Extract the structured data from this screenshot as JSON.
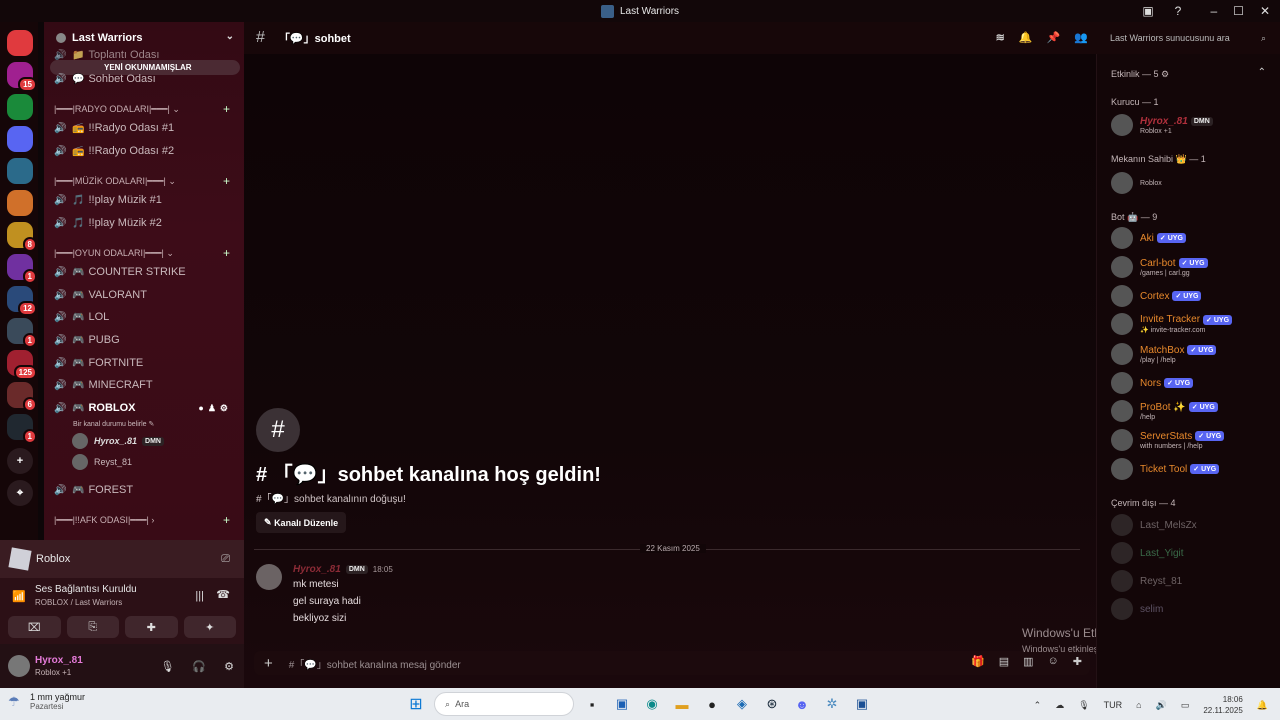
{
  "window": {
    "title": "Last Warriors"
  },
  "servers": [
    {
      "icon": "discord-logo-icon",
      "color": "#e03a3e",
      "badge": ""
    },
    {
      "icon": "server-icon",
      "color": "#a02090",
      "badge": "15"
    },
    {
      "icon": "server-icon",
      "color": "#1a8a3a",
      "badge": ""
    },
    {
      "icon": "server-icon",
      "color": "#5865f2",
      "badge": ""
    },
    {
      "icon": "server-icon",
      "color": "#2b6a8a",
      "badge": ""
    },
    {
      "icon": "server-icon",
      "color": "#d0702a",
      "badge": ""
    },
    {
      "icon": "server-icon",
      "color": "#c09020",
      "badge": "8"
    },
    {
      "icon": "server-icon",
      "color": "#7030a0",
      "badge": "1"
    },
    {
      "icon": "server-icon",
      "color": "#2a4a7a",
      "badge": "12"
    },
    {
      "icon": "server-icon",
      "color": "#3a4a5a",
      "badge": "1"
    },
    {
      "icon": "server-icon",
      "color": "#a02030",
      "badge": "125"
    },
    {
      "icon": "server-icon",
      "color": "#6a2a2a",
      "badge": "6"
    },
    {
      "icon": "server-icon",
      "color": "#202830",
      "badge": "1"
    }
  ],
  "sidebar": {
    "server_name": "Last Warriors",
    "unread_pill": "YENİ OKUNMAMIŞLAR",
    "partial_channel": "Toplantı Odası",
    "sohbet_odasi": "Sohbet Odası",
    "categories": {
      "radyo": "|━━━|RADYO ODALARI|━━━|",
      "muzik": "|━━━|MÜZİK ODALARI|━━━|",
      "oyun": "|━━━|OYUN ODALARI|━━━|",
      "afk": "|━━━|!!AFK ODASI|━━━|"
    },
    "radyo": [
      "!!Radyo Odası #1",
      "!!Radyo Odası #2"
    ],
    "muzik": [
      "!!play Müzik #1",
      "!!play Müzik #2"
    ],
    "oyun": [
      "COUNTER STRIKE",
      "VALORANT",
      "LOL",
      "PUBG",
      "FORTNITE",
      "MINECRAFT",
      "ROBLOX"
    ],
    "roblox_status": "Bir kanal durumu belirle",
    "voice_users": [
      {
        "name": "Hyrox_.81",
        "tag": "DMN"
      },
      {
        "name": "Reyst_81",
        "tag": ""
      }
    ],
    "forest": "FOREST"
  },
  "voice_panel": {
    "activity": "Roblox",
    "status": "Ses Bağlantısı Kuruldu",
    "location": "ROBLOX / Last Warriors",
    "user": "Hyrox_.81",
    "user_status": "Roblox +1"
  },
  "channel": {
    "name": "「💬」sohbet",
    "welcome_title": "# 「💬」sohbet kanalına hoş geldin!",
    "welcome_sub": "#「💬」sohbet kanalının doğuşu!",
    "edit_button": "Kanalı Düzenle",
    "date": "22 Kasım 2025",
    "search_placeholder": "Last Warriors sunucusunu ara",
    "composer_placeholder": "#「💬」sohbet kanalına mesaj gönder"
  },
  "message": {
    "author": "Hyrox_.81",
    "tag": "DMN",
    "time": "18:05",
    "lines": [
      "mk metesi",
      "gel suraya hadi",
      "bekliyoz sizi"
    ]
  },
  "members": {
    "activity_header": "Etkinlik — 5",
    "kurucu_header": "Kurucu — 1",
    "mekan_header": "Mekanın Sahibi 👑 — 1",
    "bot_header": "Bot 🤖 — 9",
    "offline_header": "Çevrim dışı — 4",
    "kurucu": {
      "name": "Hyrox_.81",
      "tag": "DMN",
      "sub": "Roblox +1",
      "color": "#b0303c"
    },
    "mekan": {
      "name": "",
      "sub": "Roblox"
    },
    "bots": [
      {
        "name": "Aki",
        "sub": "",
        "color": "#e8892c"
      },
      {
        "name": "Carl-bot",
        "sub": "/games | carl.gg",
        "color": "#e8892c"
      },
      {
        "name": "Cortex",
        "sub": "",
        "color": "#e8892c"
      },
      {
        "name": "Invite Tracker",
        "sub": "✨ invite-tracker.com",
        "color": "#e8892c"
      },
      {
        "name": "MatchBox",
        "sub": "/play | /help",
        "color": "#e8892c"
      },
      {
        "name": "Nors",
        "sub": "",
        "color": "#e8892c"
      },
      {
        "name": "ProBot ✨",
        "sub": "/help",
        "color": "#e8892c"
      },
      {
        "name": "ServerStats",
        "sub": "with numbers | /help",
        "color": "#e8892c"
      },
      {
        "name": "Ticket Tool",
        "sub": "",
        "color": "#e8892c"
      }
    ],
    "bot_tag": "UYG",
    "offline": [
      {
        "name": "Last_MelsZx",
        "color": "#6d6264"
      },
      {
        "name": "Last_Yigit",
        "color": "#3a6a48"
      },
      {
        "name": "Reyst_81",
        "color": "#6d6264"
      },
      {
        "name": "selim",
        "color": "#5d5264"
      }
    ]
  },
  "watermark": {
    "title": "Windows'u Etkinleştir",
    "sub": "Windows'u etkinleştirmek için Ayarlar'a gidin."
  },
  "taskbar": {
    "weather": "1 mm yağmur",
    "weather_sub": "Pazartesi",
    "search": "Ara",
    "lang": "TUR",
    "time": "18:06",
    "date": "22.11.2025"
  }
}
